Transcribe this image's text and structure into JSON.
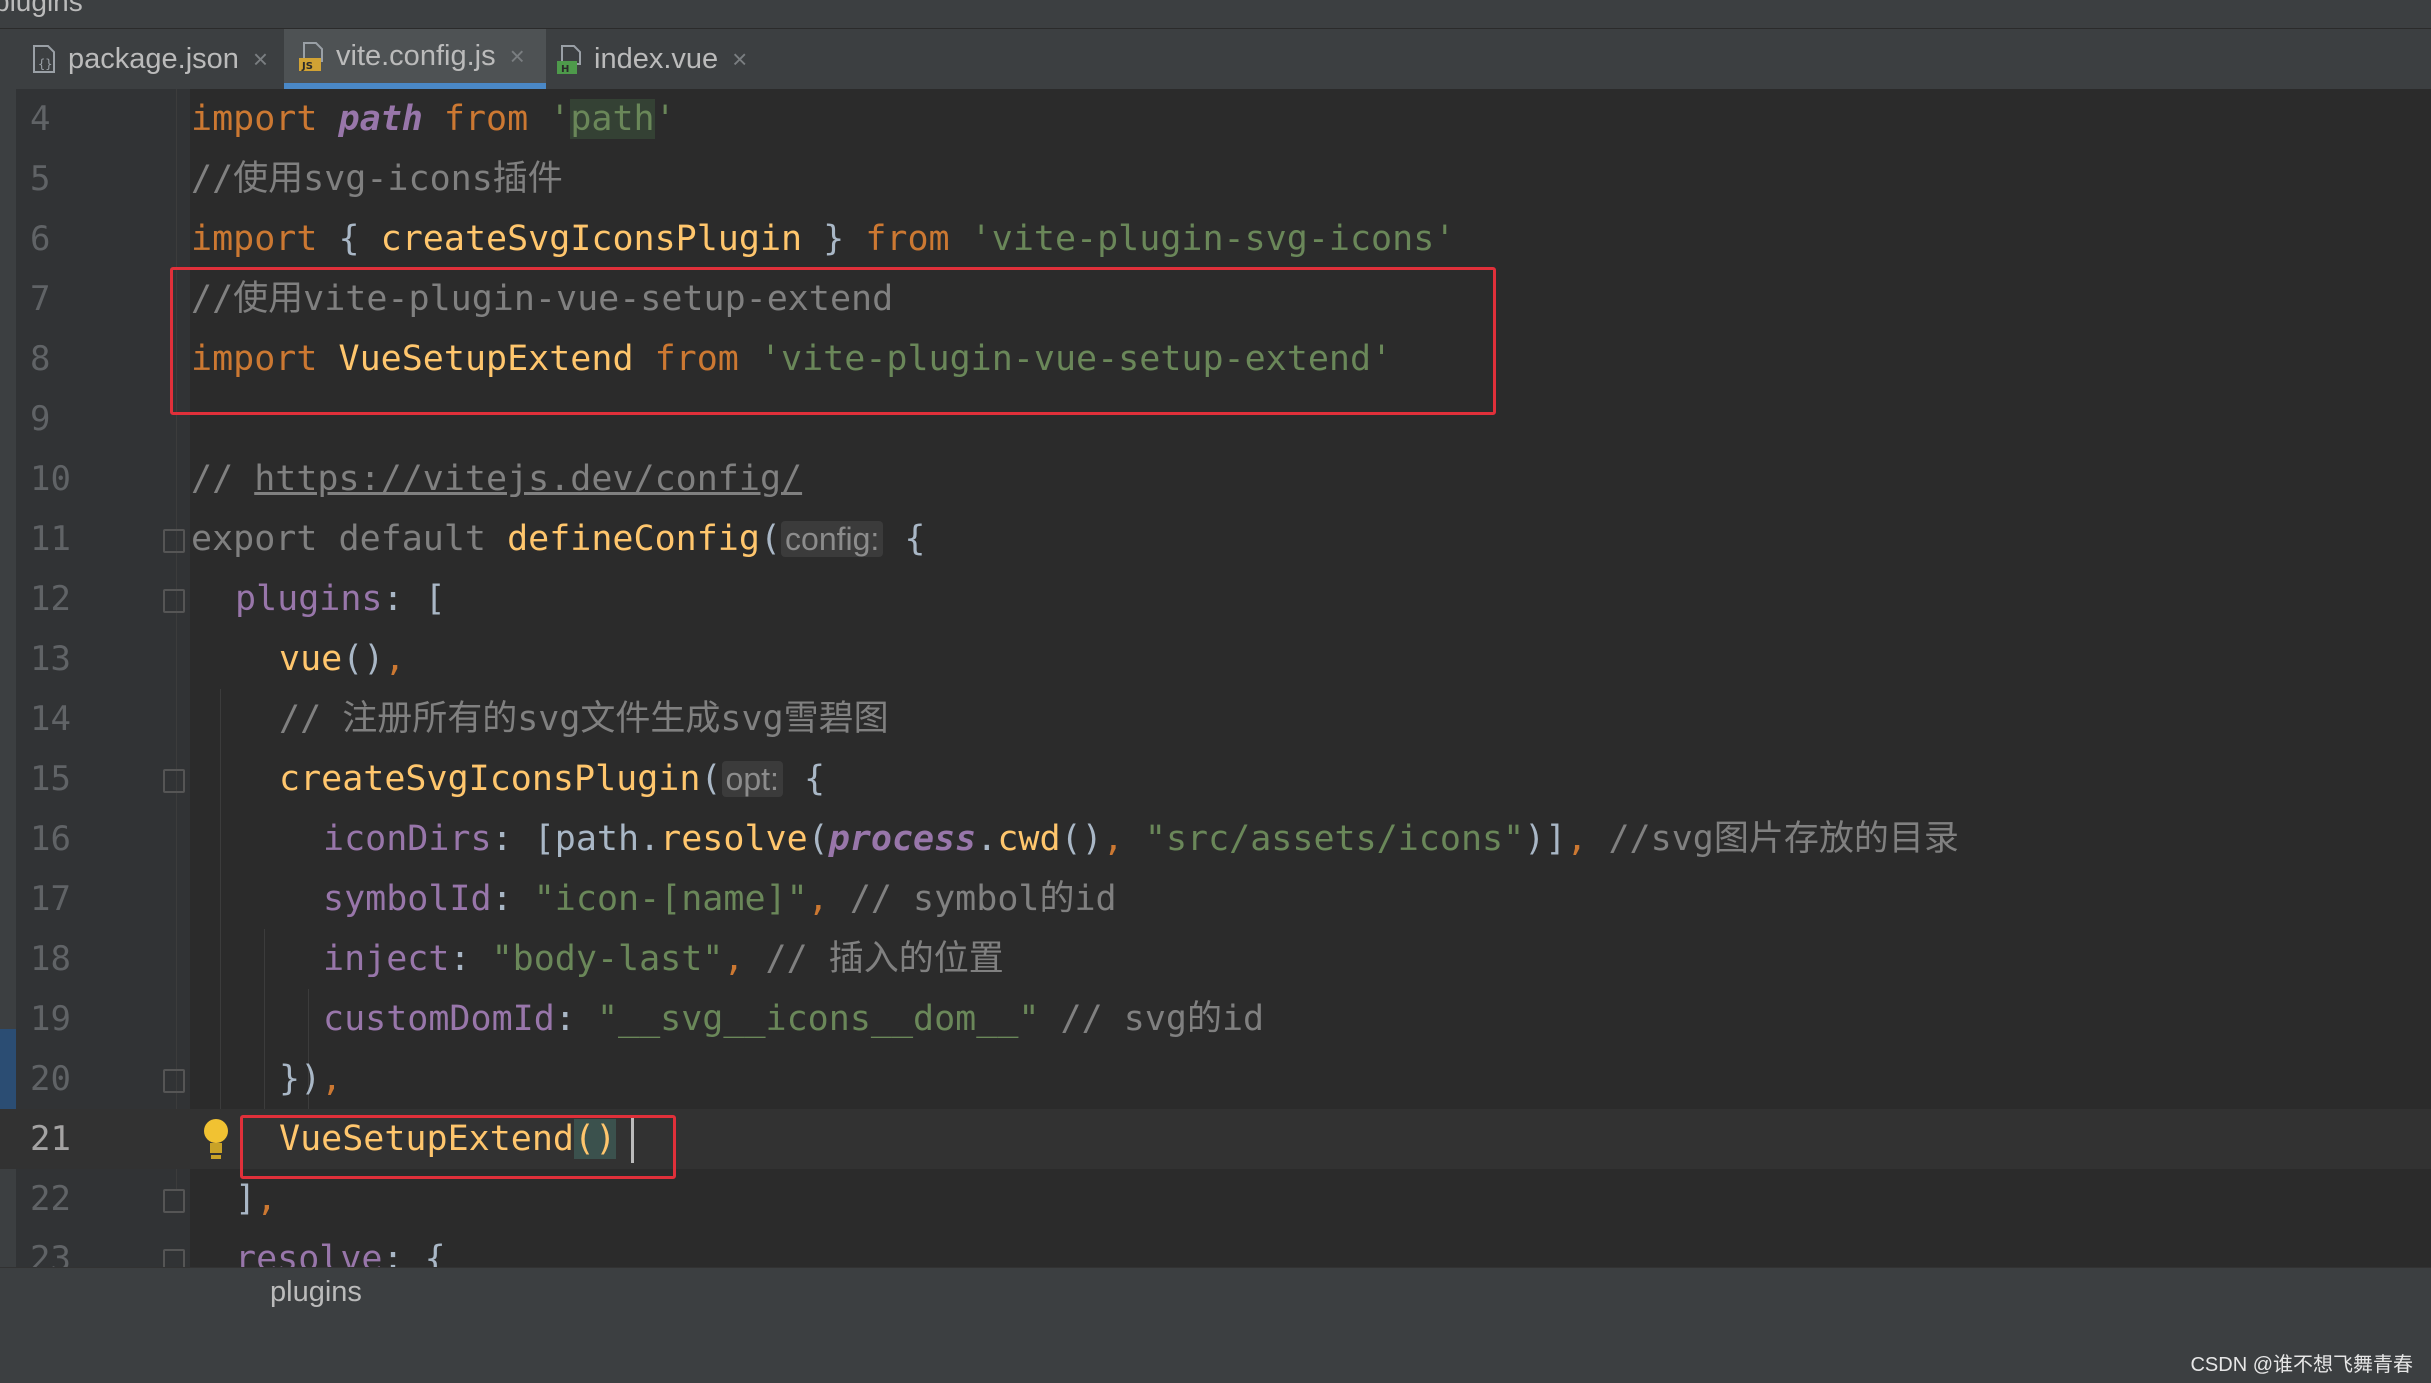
{
  "breadcrumb_top": "plugins",
  "tabs": [
    {
      "label": "package.json",
      "icon": "json-file-icon",
      "active": false
    },
    {
      "label": "vite.config.js",
      "icon": "js-file-icon",
      "active": true
    },
    {
      "label": "index.vue",
      "icon": "vue-file-icon",
      "active": false
    }
  ],
  "tab_close_glyph": "×",
  "editor": {
    "line_numbers": [
      "4",
      "5",
      "6",
      "7",
      "8",
      "9",
      "10",
      "11",
      "12",
      "13",
      "14",
      "15",
      "16",
      "17",
      "18",
      "19",
      "20",
      "21",
      "22",
      "23"
    ],
    "current_line": "21",
    "lines": {
      "l4": {
        "import": "import",
        "path": "path",
        "from": "from",
        "q1": "'",
        "str": "path",
        "q2": "'"
      },
      "l5": {
        "comment": "//使用svg-icons插件"
      },
      "l6": {
        "import": "import",
        "open": " { ",
        "name": "createSvgIconsPlugin",
        "close": " } ",
        "from": "from",
        "str": " 'vite-plugin-svg-icons'"
      },
      "l7": {
        "comment": "//使用vite-plugin-vue-setup-extend"
      },
      "l8": {
        "import": "import",
        "name": " VueSetupExtend ",
        "from": "from",
        "str": " 'vite-plugin-vue-setup-extend'"
      },
      "l10": {
        "slashes": "// ",
        "url": "https://vitejs.dev/config/"
      },
      "l11": {
        "export": "export default ",
        "fn": "defineConfig",
        "paren": "(",
        "hint": "config:",
        "brace": " {"
      },
      "l12": {
        "prop": "plugins",
        "rest": ": ["
      },
      "l13": {
        "fn": "vue",
        "paren": "()",
        "comma": ","
      },
      "l14": {
        "comment": "// 注册所有的svg文件生成svg雪碧图"
      },
      "l15": {
        "fn": "createSvgIconsPlugin",
        "paren": "(",
        "hint": "opt:",
        "brace": " {"
      },
      "l16": {
        "prop": "iconDirs",
        "p1": ": [path.",
        "fn1": "resolve",
        "p2": "(",
        "proc": "process",
        "p3": ".",
        "fn2": "cwd",
        "p4": "()",
        "c1": ", ",
        "str": "\"src/assets/icons\"",
        "p5": ")]",
        "c2": ", ",
        "comment": "//svg图片存放的目录"
      },
      "l17": {
        "prop": "symbolId",
        "p1": ": ",
        "str": "\"icon-[name]\"",
        "c1": ", ",
        "comment": "// symbol的id"
      },
      "l18": {
        "prop": "inject",
        "p1": ": ",
        "str": "\"body-last\"",
        "c1": ", ",
        "comment": "// 插入的位置"
      },
      "l19": {
        "prop": "customDomId",
        "p1": ": ",
        "str": "\"__svg__icons__dom__\"",
        "comment": " // svg的id"
      },
      "l20": {
        "p1": "})",
        "c1": ","
      },
      "l21": {
        "fn": "VueSetupExtend",
        "paren": "()"
      },
      "l22": {
        "p1": "]",
        "c1": ","
      },
      "l23": {
        "prop": "resolve",
        "rest": ": {"
      }
    }
  },
  "status_breadcrumb": "plugins",
  "watermark": "CSDN @谁不想飞舞青春",
  "colors": {
    "keyword": "#cc7832",
    "function": "#ffc66d",
    "string": "#6a8759",
    "comment": "#808080",
    "property": "#9876aa",
    "plain": "#a9b7c6",
    "highlight_box": "#e0303a"
  }
}
